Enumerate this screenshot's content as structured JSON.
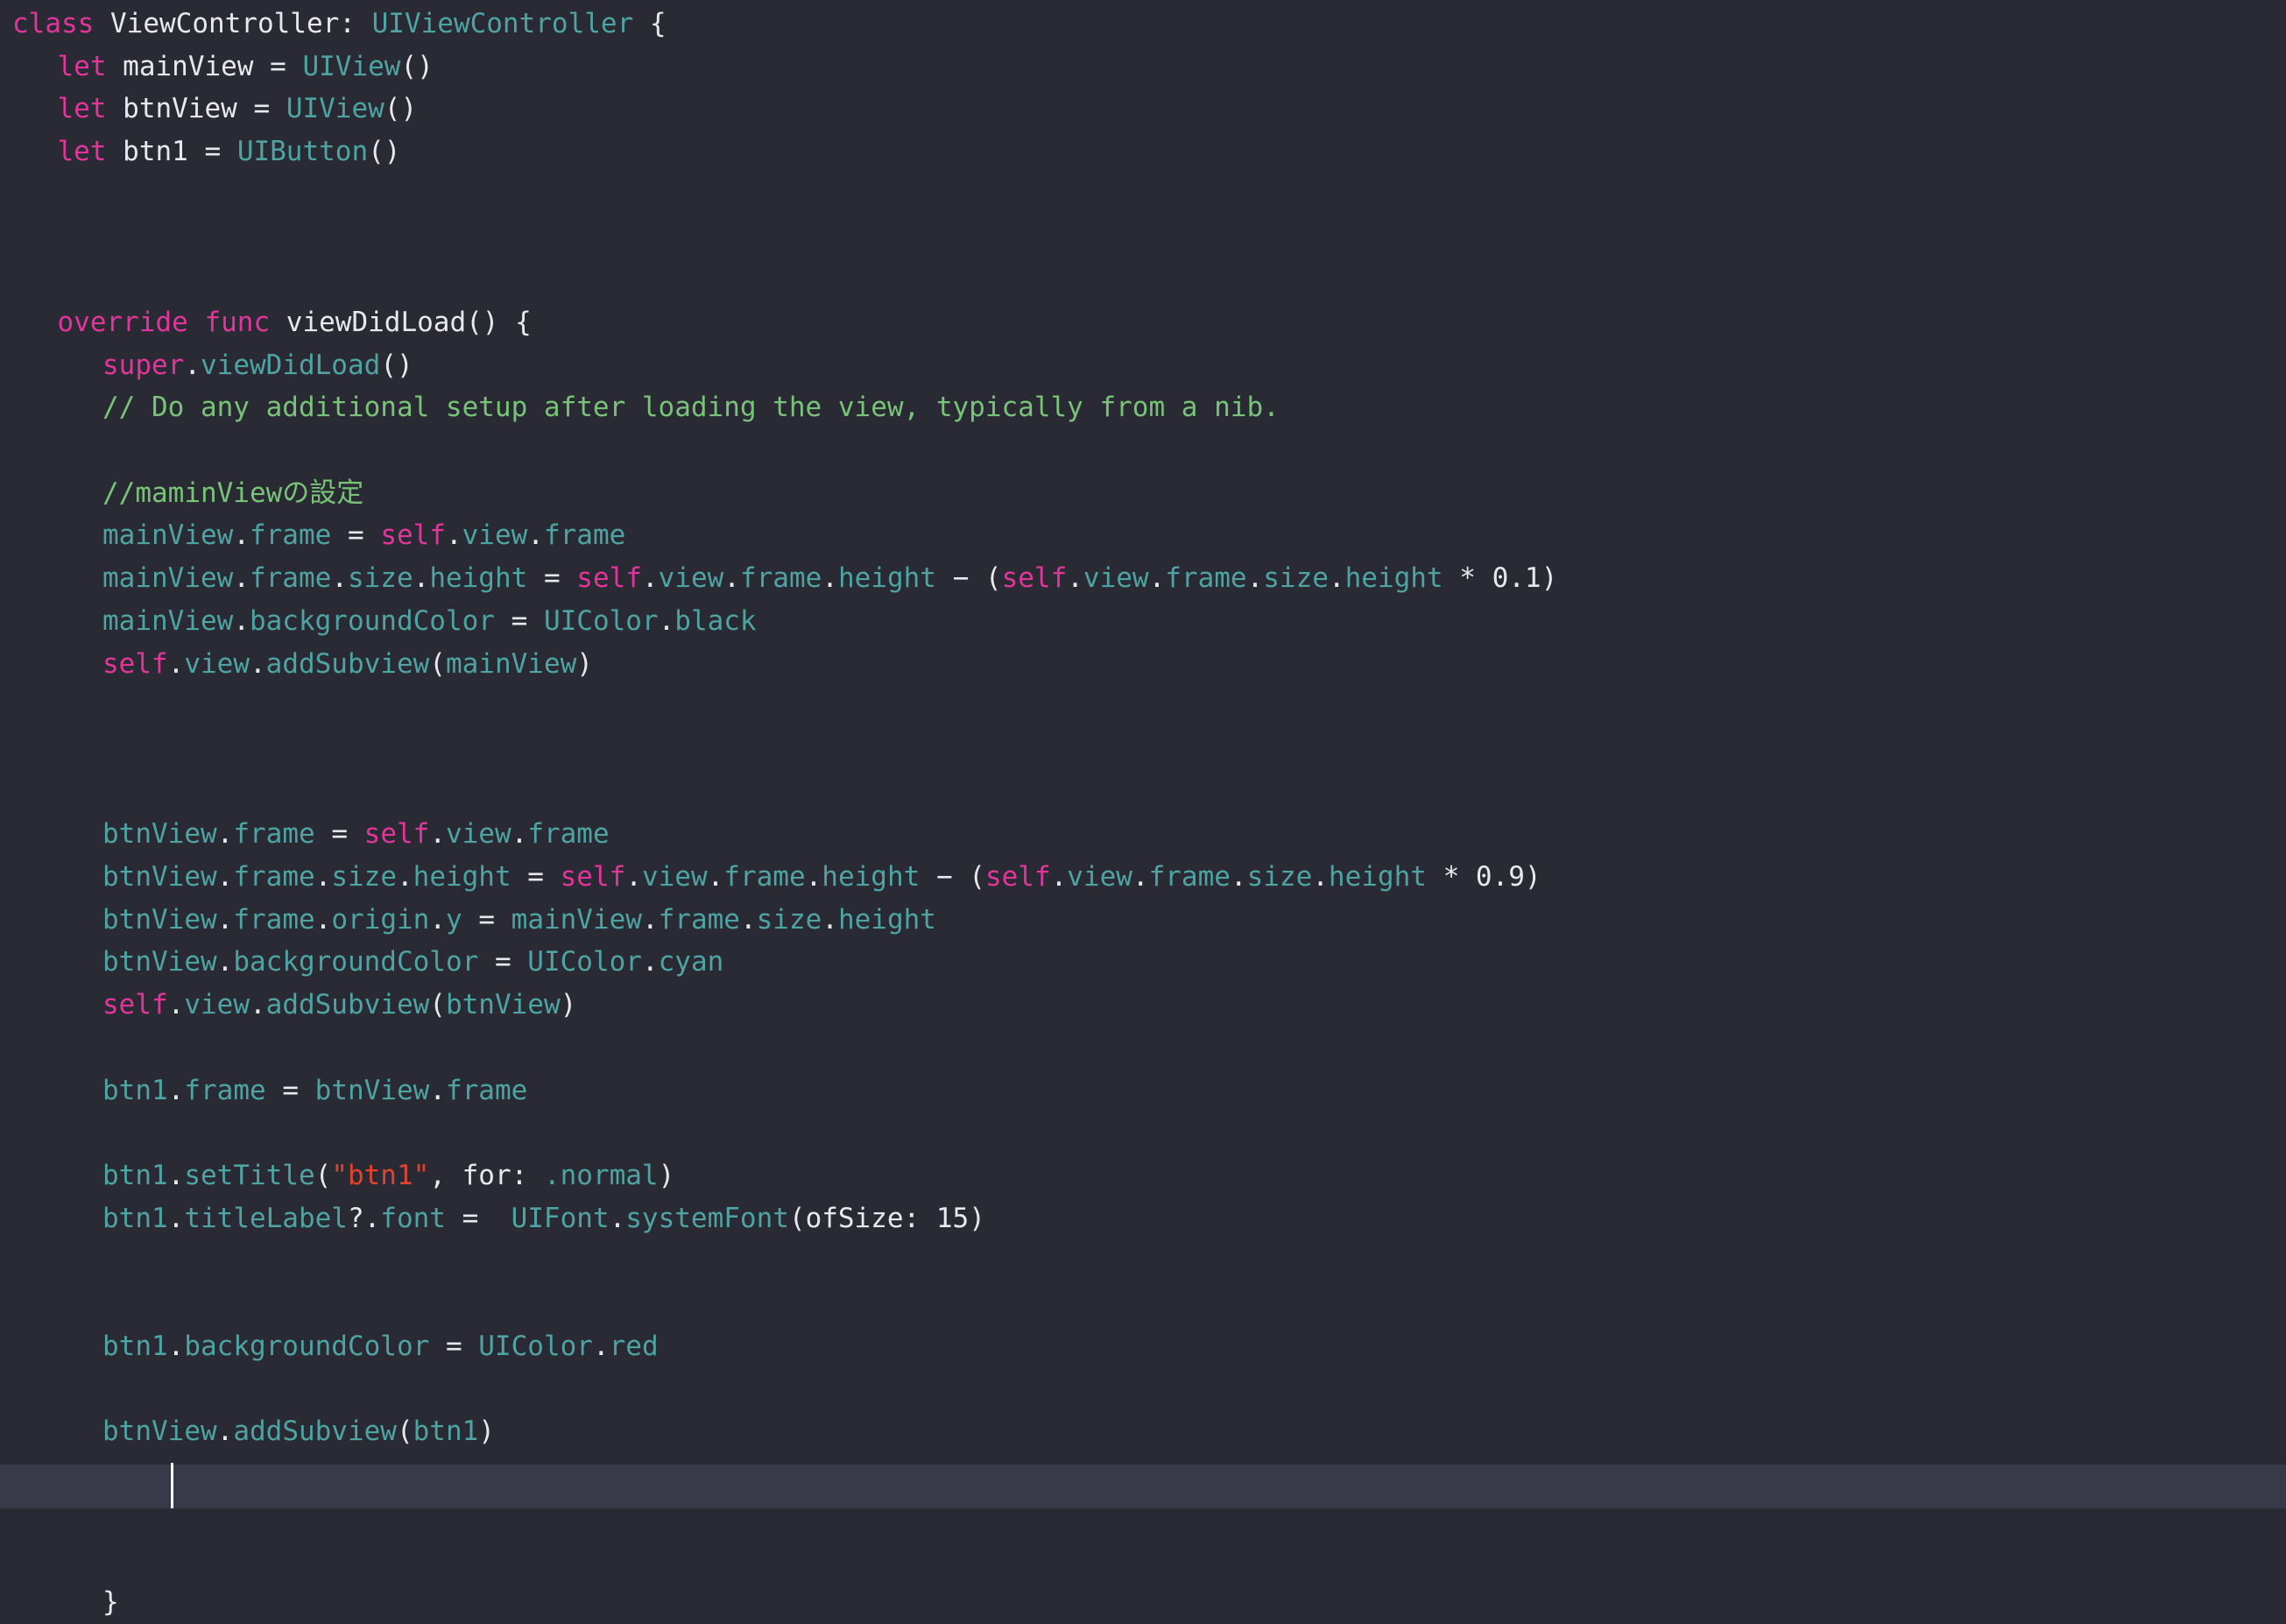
{
  "editor": {
    "language": "Swift",
    "background_color": "#292a33",
    "current_line_highlight_color": "#383a4a",
    "font_size_px": 31,
    "line_height_px": 48.7,
    "caret_visible": true,
    "caret_line_index": 33,
    "theme_colors": {
      "keyword": "#e0359a",
      "type": "#4ea3a3",
      "identifier": "#4ea3a3",
      "plain": "#e8e8ee",
      "comment": "#79c379",
      "string": "#e0432f",
      "number": "#e8e8ee"
    }
  },
  "code": {
    "lines": [
      {
        "n": 1,
        "indent": 0,
        "tokens": [
          {
            "t": "class",
            "c": "kw"
          },
          {
            "t": " ",
            "c": "plain"
          },
          {
            "t": "ViewController",
            "c": "plain"
          },
          {
            "t": ": ",
            "c": "plain"
          },
          {
            "t": "UIViewController",
            "c": "type"
          },
          {
            "t": " {",
            "c": "plain"
          }
        ]
      },
      {
        "n": 2,
        "indent": 1,
        "tokens": [
          {
            "t": "let",
            "c": "kw"
          },
          {
            "t": " mainView ",
            "c": "plain"
          },
          {
            "t": "= ",
            "c": "plain"
          },
          {
            "t": "UIView",
            "c": "type"
          },
          {
            "t": "()",
            "c": "plain"
          }
        ]
      },
      {
        "n": 3,
        "indent": 1,
        "tokens": [
          {
            "t": "let",
            "c": "kw"
          },
          {
            "t": " btnView ",
            "c": "plain"
          },
          {
            "t": "= ",
            "c": "plain"
          },
          {
            "t": "UIView",
            "c": "type"
          },
          {
            "t": "()",
            "c": "plain"
          }
        ]
      },
      {
        "n": 4,
        "indent": 1,
        "tokens": [
          {
            "t": "let",
            "c": "kw"
          },
          {
            "t": " btn1 ",
            "c": "plain"
          },
          {
            "t": "= ",
            "c": "plain"
          },
          {
            "t": "UIButton",
            "c": "type"
          },
          {
            "t": "()",
            "c": "plain"
          }
        ]
      },
      {
        "n": 5,
        "indent": 0,
        "tokens": []
      },
      {
        "n": 6,
        "indent": 0,
        "tokens": []
      },
      {
        "n": 7,
        "indent": 0,
        "tokens": []
      },
      {
        "n": 8,
        "indent": 1,
        "tokens": [
          {
            "t": "override",
            "c": "kw"
          },
          {
            "t": " ",
            "c": "plain"
          },
          {
            "t": "func",
            "c": "kw"
          },
          {
            "t": " viewDidLoad() {",
            "c": "plain"
          }
        ]
      },
      {
        "n": 9,
        "indent": 2,
        "tokens": [
          {
            "t": "super",
            "c": "kw"
          },
          {
            "t": ".",
            "c": "plain"
          },
          {
            "t": "viewDidLoad",
            "c": "ident"
          },
          {
            "t": "()",
            "c": "plain"
          }
        ]
      },
      {
        "n": 10,
        "indent": 2,
        "tokens": [
          {
            "t": "// Do any additional setup after loading the view, typically from a nib.",
            "c": "cmt"
          }
        ]
      },
      {
        "n": 11,
        "indent": 0,
        "tokens": []
      },
      {
        "n": 12,
        "indent": 2,
        "tokens": [
          {
            "t": "//maminViewの設定",
            "c": "cmt"
          }
        ]
      },
      {
        "n": 13,
        "indent": 2,
        "tokens": [
          {
            "t": "mainView",
            "c": "ident"
          },
          {
            "t": ".",
            "c": "plain"
          },
          {
            "t": "frame",
            "c": "ident"
          },
          {
            "t": " = ",
            "c": "plain"
          },
          {
            "t": "self",
            "c": "kw"
          },
          {
            "t": ".",
            "c": "plain"
          },
          {
            "t": "view",
            "c": "ident"
          },
          {
            "t": ".",
            "c": "plain"
          },
          {
            "t": "frame",
            "c": "ident"
          }
        ]
      },
      {
        "n": 14,
        "indent": 2,
        "tokens": [
          {
            "t": "mainView",
            "c": "ident"
          },
          {
            "t": ".",
            "c": "plain"
          },
          {
            "t": "frame",
            "c": "ident"
          },
          {
            "t": ".",
            "c": "plain"
          },
          {
            "t": "size",
            "c": "ident"
          },
          {
            "t": ".",
            "c": "plain"
          },
          {
            "t": "height",
            "c": "ident"
          },
          {
            "t": " = ",
            "c": "plain"
          },
          {
            "t": "self",
            "c": "kw"
          },
          {
            "t": ".",
            "c": "plain"
          },
          {
            "t": "view",
            "c": "ident"
          },
          {
            "t": ".",
            "c": "plain"
          },
          {
            "t": "frame",
            "c": "ident"
          },
          {
            "t": ".",
            "c": "plain"
          },
          {
            "t": "height",
            "c": "ident"
          },
          {
            "t": " − (",
            "c": "plain"
          },
          {
            "t": "self",
            "c": "kw"
          },
          {
            "t": ".",
            "c": "plain"
          },
          {
            "t": "view",
            "c": "ident"
          },
          {
            "t": ".",
            "c": "plain"
          },
          {
            "t": "frame",
            "c": "ident"
          },
          {
            "t": ".",
            "c": "plain"
          },
          {
            "t": "size",
            "c": "ident"
          },
          {
            "t": ".",
            "c": "plain"
          },
          {
            "t": "height",
            "c": "ident"
          },
          {
            "t": " * ",
            "c": "plain"
          },
          {
            "t": "0.1",
            "c": "num"
          },
          {
            "t": ")",
            "c": "plain"
          }
        ]
      },
      {
        "n": 15,
        "indent": 2,
        "tokens": [
          {
            "t": "mainView",
            "c": "ident"
          },
          {
            "t": ".",
            "c": "plain"
          },
          {
            "t": "backgroundColor",
            "c": "ident"
          },
          {
            "t": " = ",
            "c": "plain"
          },
          {
            "t": "UIColor",
            "c": "type"
          },
          {
            "t": ".",
            "c": "plain"
          },
          {
            "t": "black",
            "c": "ident"
          }
        ]
      },
      {
        "n": 16,
        "indent": 2,
        "tokens": [
          {
            "t": "self",
            "c": "kw"
          },
          {
            "t": ".",
            "c": "plain"
          },
          {
            "t": "view",
            "c": "ident"
          },
          {
            "t": ".",
            "c": "plain"
          },
          {
            "t": "addSubview",
            "c": "ident"
          },
          {
            "t": "(",
            "c": "plain"
          },
          {
            "t": "mainView",
            "c": "ident"
          },
          {
            "t": ")",
            "c": "plain"
          }
        ]
      },
      {
        "n": 17,
        "indent": 0,
        "tokens": []
      },
      {
        "n": 18,
        "indent": 0,
        "tokens": []
      },
      {
        "n": 19,
        "indent": 0,
        "tokens": []
      },
      {
        "n": 20,
        "indent": 2,
        "tokens": [
          {
            "t": "btnView",
            "c": "ident"
          },
          {
            "t": ".",
            "c": "plain"
          },
          {
            "t": "frame",
            "c": "ident"
          },
          {
            "t": " = ",
            "c": "plain"
          },
          {
            "t": "self",
            "c": "kw"
          },
          {
            "t": ".",
            "c": "plain"
          },
          {
            "t": "view",
            "c": "ident"
          },
          {
            "t": ".",
            "c": "plain"
          },
          {
            "t": "frame",
            "c": "ident"
          }
        ]
      },
      {
        "n": 21,
        "indent": 2,
        "tokens": [
          {
            "t": "btnView",
            "c": "ident"
          },
          {
            "t": ".",
            "c": "plain"
          },
          {
            "t": "frame",
            "c": "ident"
          },
          {
            "t": ".",
            "c": "plain"
          },
          {
            "t": "size",
            "c": "ident"
          },
          {
            "t": ".",
            "c": "plain"
          },
          {
            "t": "height",
            "c": "ident"
          },
          {
            "t": " = ",
            "c": "plain"
          },
          {
            "t": "self",
            "c": "kw"
          },
          {
            "t": ".",
            "c": "plain"
          },
          {
            "t": "view",
            "c": "ident"
          },
          {
            "t": ".",
            "c": "plain"
          },
          {
            "t": "frame",
            "c": "ident"
          },
          {
            "t": ".",
            "c": "plain"
          },
          {
            "t": "height",
            "c": "ident"
          },
          {
            "t": " − (",
            "c": "plain"
          },
          {
            "t": "self",
            "c": "kw"
          },
          {
            "t": ".",
            "c": "plain"
          },
          {
            "t": "view",
            "c": "ident"
          },
          {
            "t": ".",
            "c": "plain"
          },
          {
            "t": "frame",
            "c": "ident"
          },
          {
            "t": ".",
            "c": "plain"
          },
          {
            "t": "size",
            "c": "ident"
          },
          {
            "t": ".",
            "c": "plain"
          },
          {
            "t": "height",
            "c": "ident"
          },
          {
            "t": " * ",
            "c": "plain"
          },
          {
            "t": "0.9",
            "c": "num"
          },
          {
            "t": ")",
            "c": "plain"
          }
        ]
      },
      {
        "n": 22,
        "indent": 2,
        "tokens": [
          {
            "t": "btnView",
            "c": "ident"
          },
          {
            "t": ".",
            "c": "plain"
          },
          {
            "t": "frame",
            "c": "ident"
          },
          {
            "t": ".",
            "c": "plain"
          },
          {
            "t": "origin",
            "c": "ident"
          },
          {
            "t": ".",
            "c": "plain"
          },
          {
            "t": "y",
            "c": "ident"
          },
          {
            "t": " = ",
            "c": "plain"
          },
          {
            "t": "mainView",
            "c": "ident"
          },
          {
            "t": ".",
            "c": "plain"
          },
          {
            "t": "frame",
            "c": "ident"
          },
          {
            "t": ".",
            "c": "plain"
          },
          {
            "t": "size",
            "c": "ident"
          },
          {
            "t": ".",
            "c": "plain"
          },
          {
            "t": "height",
            "c": "ident"
          }
        ]
      },
      {
        "n": 23,
        "indent": 2,
        "tokens": [
          {
            "t": "btnView",
            "c": "ident"
          },
          {
            "t": ".",
            "c": "plain"
          },
          {
            "t": "backgroundColor",
            "c": "ident"
          },
          {
            "t": " = ",
            "c": "plain"
          },
          {
            "t": "UIColor",
            "c": "type"
          },
          {
            "t": ".",
            "c": "plain"
          },
          {
            "t": "cyan",
            "c": "ident"
          }
        ]
      },
      {
        "n": 24,
        "indent": 2,
        "tokens": [
          {
            "t": "self",
            "c": "kw"
          },
          {
            "t": ".",
            "c": "plain"
          },
          {
            "t": "view",
            "c": "ident"
          },
          {
            "t": ".",
            "c": "plain"
          },
          {
            "t": "addSubview",
            "c": "ident"
          },
          {
            "t": "(",
            "c": "plain"
          },
          {
            "t": "btnView",
            "c": "ident"
          },
          {
            "t": ")",
            "c": "plain"
          }
        ]
      },
      {
        "n": 25,
        "indent": 0,
        "tokens": []
      },
      {
        "n": 26,
        "indent": 2,
        "tokens": [
          {
            "t": "btn1",
            "c": "ident"
          },
          {
            "t": ".",
            "c": "plain"
          },
          {
            "t": "frame",
            "c": "ident"
          },
          {
            "t": " = ",
            "c": "plain"
          },
          {
            "t": "btnView",
            "c": "ident"
          },
          {
            "t": ".",
            "c": "plain"
          },
          {
            "t": "frame",
            "c": "ident"
          }
        ]
      },
      {
        "n": 27,
        "indent": 0,
        "tokens": []
      },
      {
        "n": 28,
        "indent": 2,
        "tokens": [
          {
            "t": "btn1",
            "c": "ident"
          },
          {
            "t": ".",
            "c": "plain"
          },
          {
            "t": "setTitle",
            "c": "ident"
          },
          {
            "t": "(",
            "c": "plain"
          },
          {
            "t": "\"btn1\"",
            "c": "str"
          },
          {
            "t": ", for: ",
            "c": "plain"
          },
          {
            "t": ".normal",
            "c": "ident"
          },
          {
            "t": ")",
            "c": "plain"
          }
        ]
      },
      {
        "n": 29,
        "indent": 2,
        "tokens": [
          {
            "t": "btn1",
            "c": "ident"
          },
          {
            "t": ".",
            "c": "plain"
          },
          {
            "t": "titleLabel",
            "c": "ident"
          },
          {
            "t": "?.",
            "c": "plain"
          },
          {
            "t": "font",
            "c": "ident"
          },
          {
            "t": " =  ",
            "c": "plain"
          },
          {
            "t": "UIFont",
            "c": "type"
          },
          {
            "t": ".",
            "c": "plain"
          },
          {
            "t": "systemFont",
            "c": "ident"
          },
          {
            "t": "(ofSize: ",
            "c": "plain"
          },
          {
            "t": "15",
            "c": "num"
          },
          {
            "t": ")",
            "c": "plain"
          }
        ]
      },
      {
        "n": 30,
        "indent": 0,
        "tokens": []
      },
      {
        "n": 31,
        "indent": 0,
        "tokens": []
      },
      {
        "n": 32,
        "indent": 2,
        "tokens": [
          {
            "t": "btn1",
            "c": "ident"
          },
          {
            "t": ".",
            "c": "plain"
          },
          {
            "t": "backgroundColor",
            "c": "ident"
          },
          {
            "t": " = ",
            "c": "plain"
          },
          {
            "t": "UIColor",
            "c": "type"
          },
          {
            "t": ".",
            "c": "plain"
          },
          {
            "t": "red",
            "c": "ident"
          }
        ]
      },
      {
        "n": 33,
        "indent": 0,
        "tokens": []
      },
      {
        "n": 34,
        "indent": 2,
        "tokens": [
          {
            "t": "btnView",
            "c": "ident"
          },
          {
            "t": ".",
            "c": "plain"
          },
          {
            "t": "addSubview",
            "c": "ident"
          },
          {
            "t": "(",
            "c": "plain"
          },
          {
            "t": "btn1",
            "c": "ident"
          },
          {
            "t": ")",
            "c": "plain"
          }
        ]
      },
      {
        "n": 35,
        "indent": 0,
        "tokens": []
      },
      {
        "n": 36,
        "indent": 0,
        "tokens": []
      },
      {
        "n": 37,
        "indent": 0,
        "tokens": []
      },
      {
        "n": 38,
        "indent": 2,
        "tokens": [
          {
            "t": "}",
            "c": "plain"
          }
        ]
      }
    ]
  }
}
